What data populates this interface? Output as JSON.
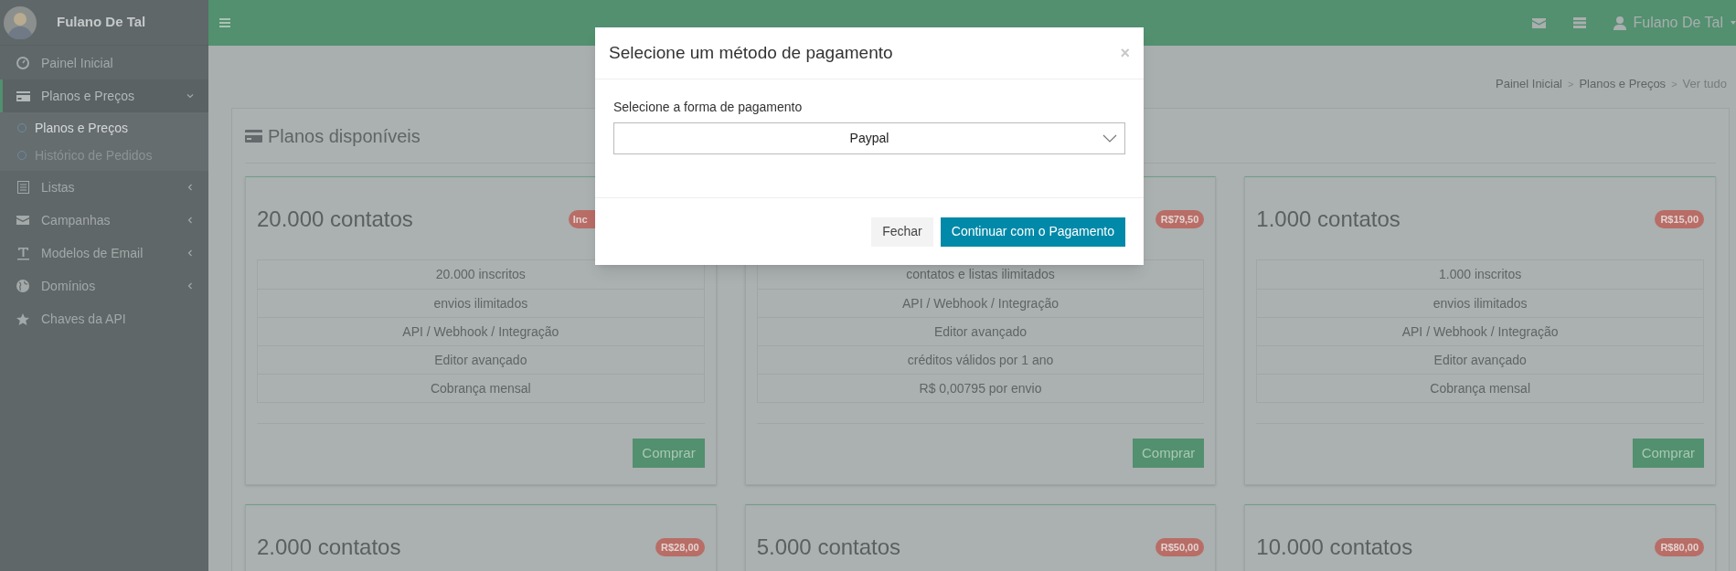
{
  "sidebar": {
    "user_name": "Fulano De Tal",
    "items": [
      {
        "label": "Painel Inicial",
        "kind": "link",
        "selected": false
      },
      {
        "label": "Planos e Preços",
        "kind": "group",
        "selected": true,
        "expanded": true,
        "children": [
          {
            "label": "Planos e Preços",
            "selected": true
          },
          {
            "label": "Histórico de Pedidos",
            "selected": false
          }
        ]
      },
      {
        "label": "Listas",
        "kind": "group",
        "selected": false,
        "expanded": false
      },
      {
        "label": "Campanhas",
        "kind": "group",
        "selected": false,
        "expanded": false
      },
      {
        "label": "Modelos de Email",
        "kind": "group",
        "selected": false,
        "expanded": false
      },
      {
        "label": "Domínios",
        "kind": "group",
        "selected": false,
        "expanded": false
      },
      {
        "label": "Chaves da API",
        "kind": "link",
        "selected": false
      }
    ]
  },
  "header": {
    "user_name": "Fulano De Tal"
  },
  "breadcrumb": [
    {
      "label": "Painel Inicial",
      "current": false
    },
    {
      "separator": ">"
    },
    {
      "label": "Planos e Preços",
      "current": false
    },
    {
      "separator": ">"
    },
    {
      "label": "Ver tudo",
      "current": true
    }
  ],
  "panel": {
    "title": "Planos disponíveis",
    "plans": [
      {
        "title": "20.000 contatos",
        "price": "Inc",
        "price_cut": true,
        "features": [
          "20.000 inscritos",
          "envios ilimitados",
          "API / Webhook / Integração",
          "Editor avançado",
          "Cobrança mensal"
        ],
        "button": "Comprar"
      },
      {
        "price": "R$79,50",
        "features": [
          "contatos e listas ilimitados",
          "API / Webhook / Integração",
          "Editor avançado",
          "créditos válidos por 1 ano",
          "R$ 0,00795 por envio"
        ],
        "button": "Comprar"
      },
      {
        "title": "1.000 contatos",
        "price": "R$15,00",
        "features": [
          "1.000 inscritos",
          "envios ilimitados",
          "API / Webhook / Integração",
          "Editor avançado",
          "Cobrança mensal"
        ],
        "button": "Comprar"
      },
      {
        "title": "2.000 contatos",
        "price": "R$28,00"
      },
      {
        "title": "5.000 contatos",
        "price": "R$50,00"
      },
      {
        "title": "10.000 contatos",
        "price": "R$80,00"
      }
    ]
  },
  "modal": {
    "title": "Selecione um método de pagamento",
    "close": "×",
    "field_label": "Selecione a forma de pagamento",
    "select_value": "Paypal",
    "buttons": [
      {
        "label": "Fechar",
        "kind": "secondary"
      },
      {
        "label": "Continuar com o Pagamento",
        "kind": "primary"
      }
    ]
  }
}
